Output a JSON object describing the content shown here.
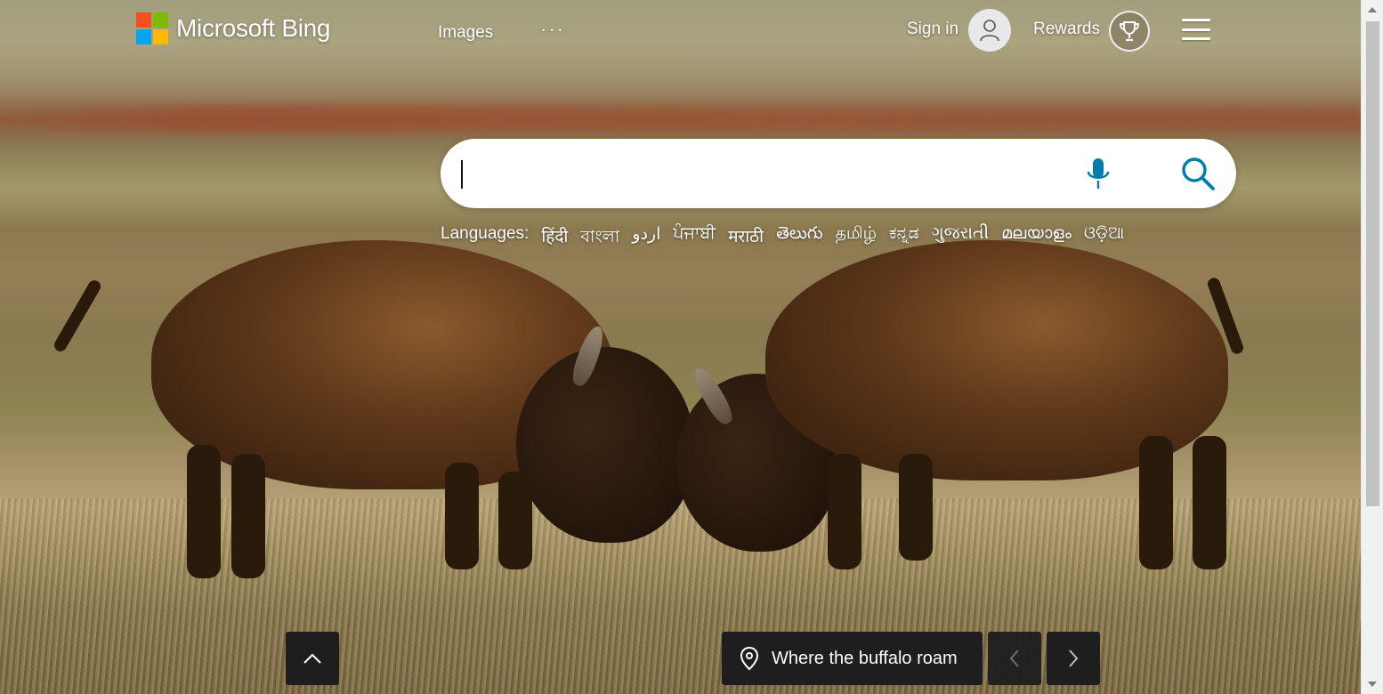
{
  "brand": {
    "name": "Microsoft Bing",
    "logo_colors": [
      "#f25022",
      "#7fba00",
      "#00a4ef",
      "#ffb900"
    ]
  },
  "nav": {
    "images": "Images",
    "more": "···"
  },
  "account": {
    "sign_in": "Sign in",
    "rewards": "Rewards"
  },
  "search": {
    "value": "",
    "placeholder": "",
    "accent_color": "#007daa"
  },
  "languages": {
    "label": "Languages:",
    "items": [
      "हिंदी",
      "বাংলা",
      "اردو",
      "ਪੰਜਾਬੀ",
      "मराठी",
      "తెలుగు",
      "தமிழ்",
      "ಕನ್ನಡ",
      "ગુજરાતી",
      "മലയാളം",
      "ଓଡ଼ିଆ"
    ]
  },
  "image_info": {
    "caption": "Where the buffalo roam"
  },
  "icons": {
    "avatar": "person-icon",
    "rewards": "trophy-icon",
    "menu": "hamburger-icon",
    "mic": "microphone-icon",
    "search": "search-icon",
    "location": "location-pin-icon",
    "scroll_up": "chevron-up-icon",
    "prev": "chevron-left-icon",
    "next": "chevron-right-icon"
  }
}
